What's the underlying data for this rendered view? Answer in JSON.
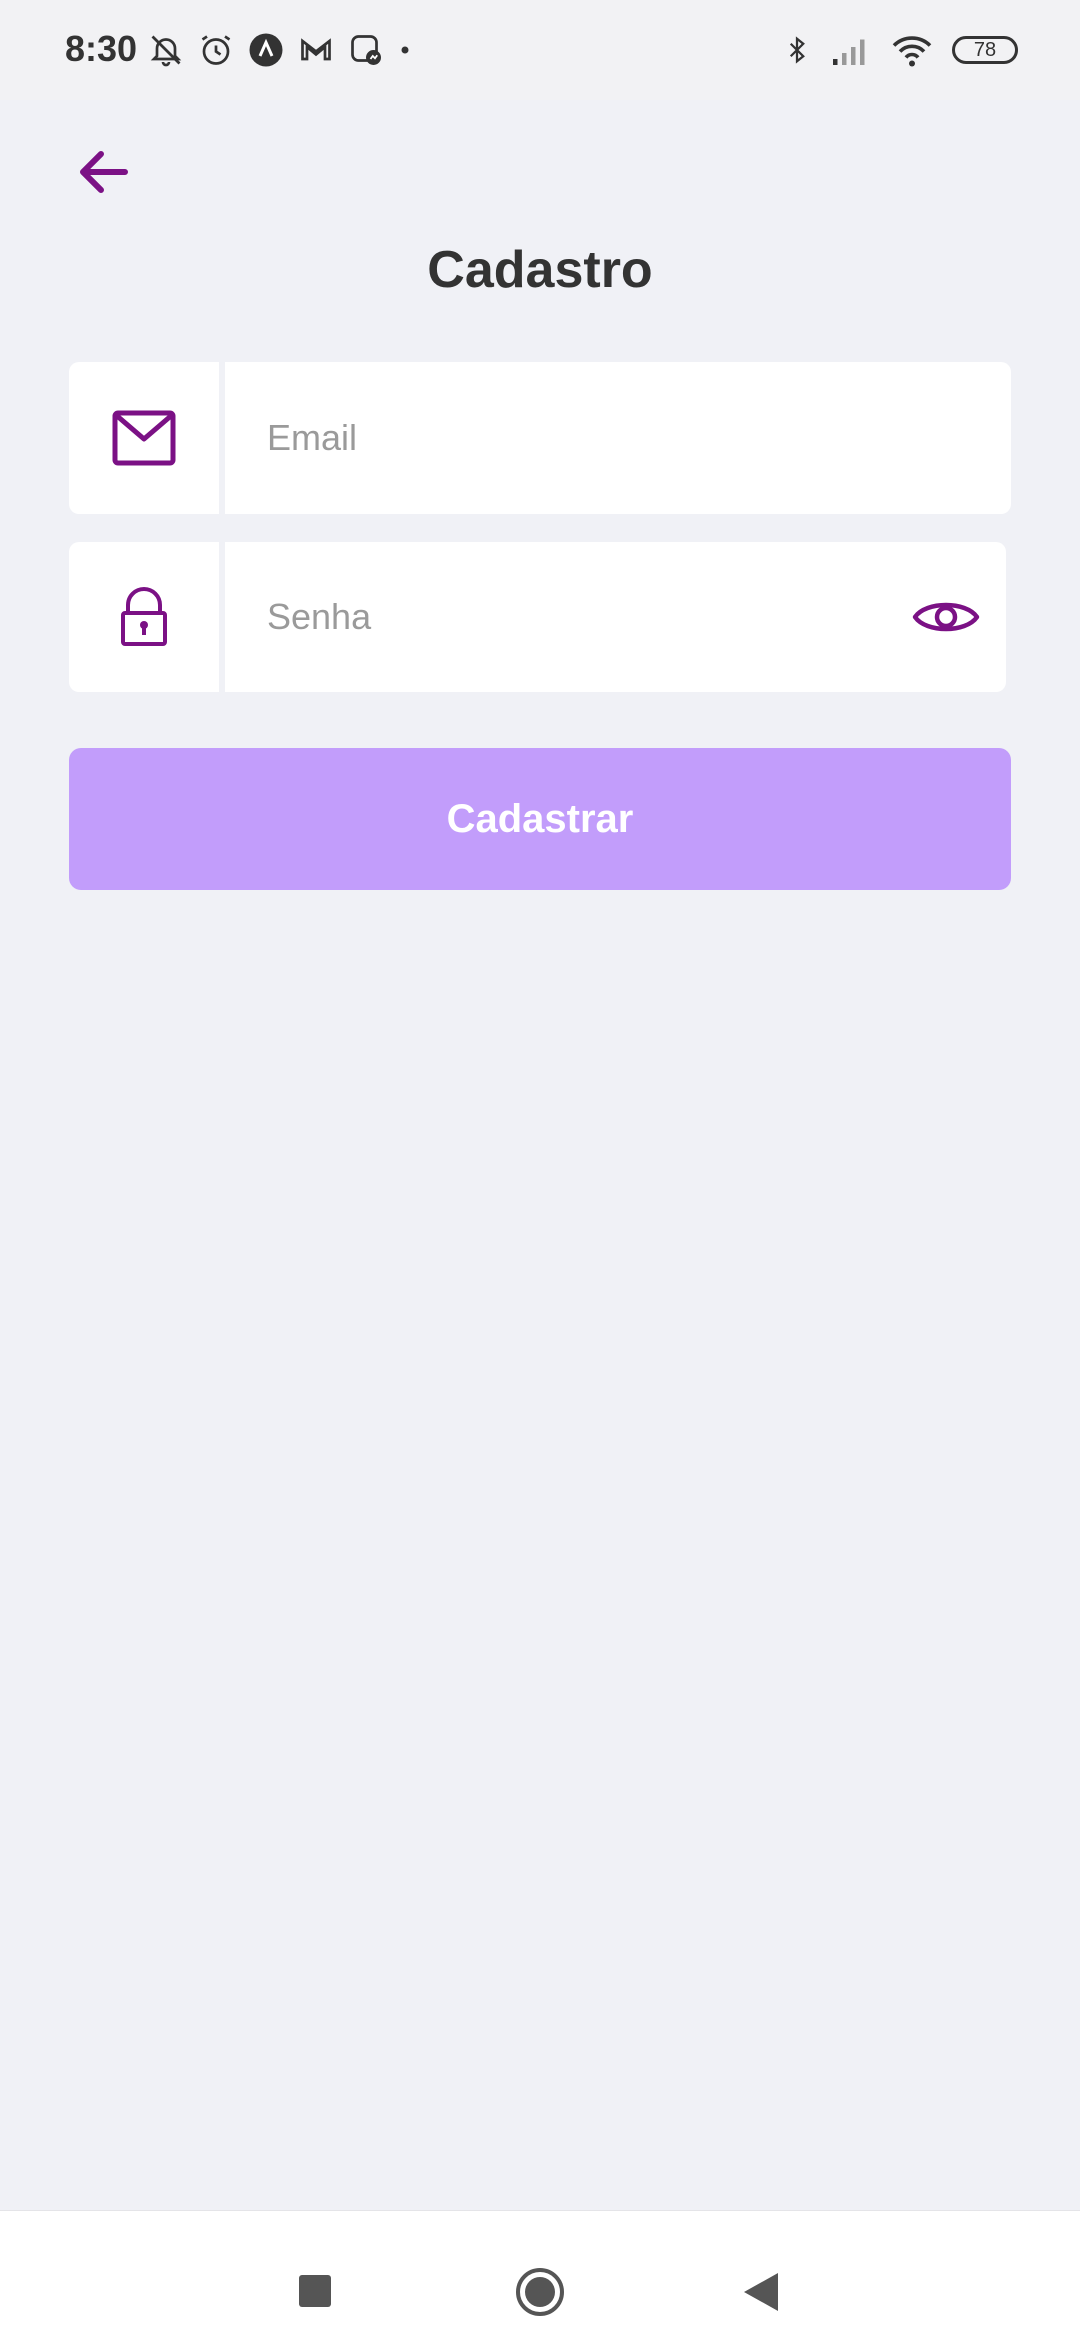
{
  "status_bar": {
    "time": "8:30",
    "battery": "78",
    "left_icons": [
      "mute-bell-icon",
      "alarm-icon",
      "app-a-icon",
      "gmail-icon",
      "messenger-icon",
      "dot-icon"
    ],
    "right_icons": [
      "bluetooth-icon",
      "signal-icon",
      "wifi-icon",
      "battery-icon"
    ]
  },
  "header": {
    "back_icon": "arrow-left-icon",
    "title": "Cadastro"
  },
  "form": {
    "email": {
      "icon": "envelope-icon",
      "placeholder": "Email",
      "value": ""
    },
    "password": {
      "icon": "lock-icon",
      "placeholder": "Senha",
      "value": "",
      "toggle_icon": "eye-icon"
    },
    "submit_label": "Cadastrar"
  },
  "colors": {
    "accent": "#7b1185",
    "button": "#c29dfb",
    "background": "#f0f1f6",
    "text": "#333333"
  },
  "nav_bar": {
    "items": [
      "recents-button",
      "home-button",
      "back-button"
    ]
  }
}
